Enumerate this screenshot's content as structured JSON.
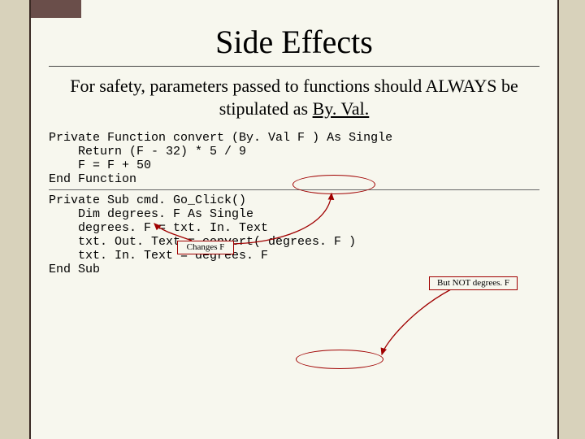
{
  "title": "Side Effects",
  "intro_part1": "For safety, parameters passed to functions should ALWAYS be stipulated as ",
  "intro_byval": "By. Val.",
  "code1": {
    "l1a": "Private Function convert (",
    "l1b": "By. Val F ",
    "l1c": ") As Single",
    "l2": "    Return (F - 32) * 5 / 9",
    "l3": "    F = F + 50",
    "l4": "End Function"
  },
  "callout1": "Changes F",
  "code2": {
    "l1": "Private Sub cmd. Go_Click()",
    "l2": "    Dim degrees. F As Single",
    "l3": "    degrees. F = txt. In. Text",
    "l4a": "    txt. Out. Text = convert( ",
    "l4b": "degrees. F ",
    "l4c": ")",
    "l5": "    txt. In. Text = degrees. F",
    "l6": "End Sub"
  },
  "callout2": "But NOT degrees. F"
}
